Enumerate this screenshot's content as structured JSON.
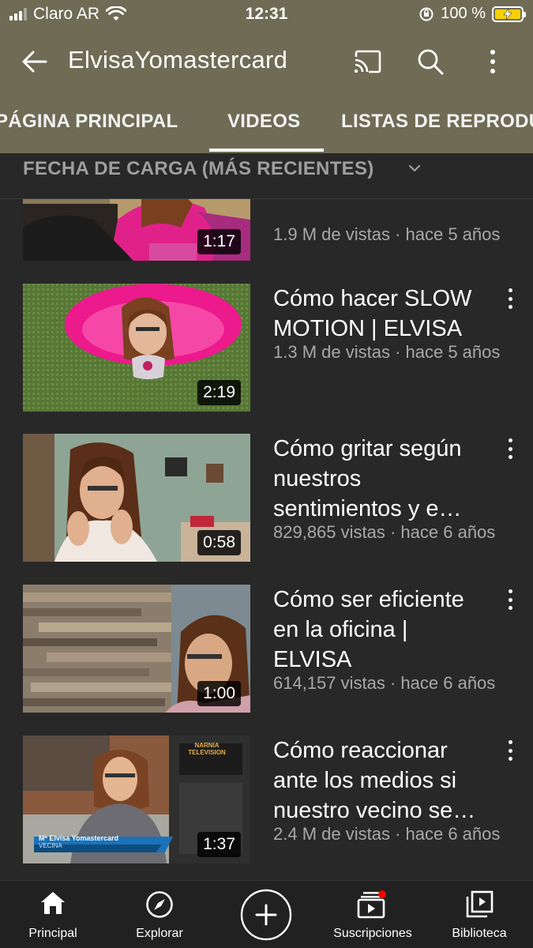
{
  "status_bar": {
    "carrier": "Claro AR",
    "time": "12:31",
    "battery_percent": "100 %",
    "battery_level": 1.0,
    "battery_color": "#f5d000"
  },
  "header": {
    "channel_name": "ElvisaYomastercard",
    "bg_color": "#6f6b55",
    "icons": [
      "back-arrow-icon",
      "cast-icon",
      "search-icon",
      "more-vert-icon"
    ]
  },
  "tabs": [
    {
      "label": "PÁGINA PRINCIPAL",
      "active": false
    },
    {
      "label": "VIDEOS",
      "active": true
    },
    {
      "label": "LISTAS DE REPRODUCCIÓN",
      "active": false
    }
  ],
  "sort": {
    "label": "FECHA DE CARGA (MÁS RECIENTES)"
  },
  "videos": [
    {
      "title": "",
      "meta": "1.9 M de vistas · hace 5 años",
      "duration": "1:17"
    },
    {
      "title": "Cómo hacer SLOW MOTION | ELVISA",
      "meta": "1.3 M de vistas · hace 5 años",
      "duration": "2:19"
    },
    {
      "title": "Cómo gritar según nuestros sentimientos y e…",
      "meta": "829,865 vistas · hace 6 años",
      "duration": "0:58"
    },
    {
      "title": "Cómo ser eficiente en la oficina | ELVISA",
      "meta": "614,157 vistas · hace 6 años",
      "duration": "1:00"
    },
    {
      "title": "Cómo reaccionar ante los medios si nuestro vecino se…",
      "meta": "2.4 M de vistas · hace 6 años",
      "duration": "1:37",
      "lower_third": {
        "name": "Mª Elvisa Yomastercard",
        "role": "VECINA",
        "sign": "NARNIA TELEVISION"
      }
    }
  ],
  "bottom_nav": [
    {
      "label": "Principal",
      "icon": "home-icon",
      "active": true
    },
    {
      "label": "Explorar",
      "icon": "compass-icon",
      "active": false
    },
    {
      "label": "",
      "icon": "create-plus-icon",
      "active": false
    },
    {
      "label": "Suscripciones",
      "icon": "subscriptions-icon",
      "active": false,
      "badge_color": "#ff0000"
    },
    {
      "label": "Biblioteca",
      "icon": "library-icon",
      "active": false
    }
  ]
}
